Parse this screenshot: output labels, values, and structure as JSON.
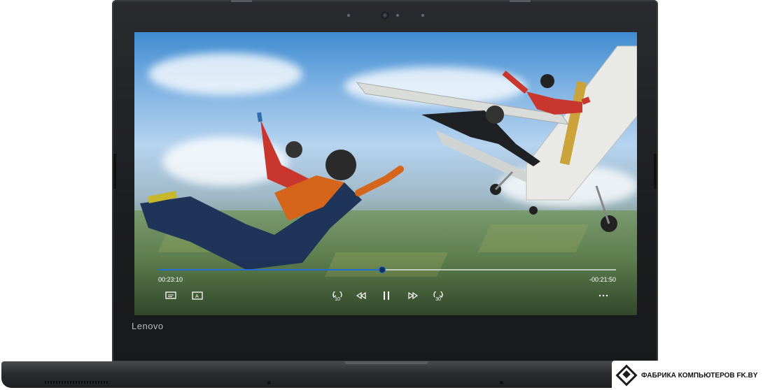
{
  "laptop": {
    "brand": "Lenovo"
  },
  "player": {
    "elapsed": "00:23:10",
    "remaining": "-00:21:50",
    "progress_fraction": 0.49,
    "buttons": {
      "captions_icon": "captions-icon",
      "cast_icon": "cast-icon",
      "rewind10_label": "10",
      "skip_back_icon": "skip-back-icon",
      "pause_icon": "pause-icon",
      "skip_forward_icon": "skip-forward-icon",
      "forward30_label": "30",
      "more_icon": "more-icon"
    },
    "accent": "#1d6fd6"
  },
  "watermark": {
    "text": "ФАБРИКА КОМПЬЮТЕРОВ FK.BY"
  }
}
